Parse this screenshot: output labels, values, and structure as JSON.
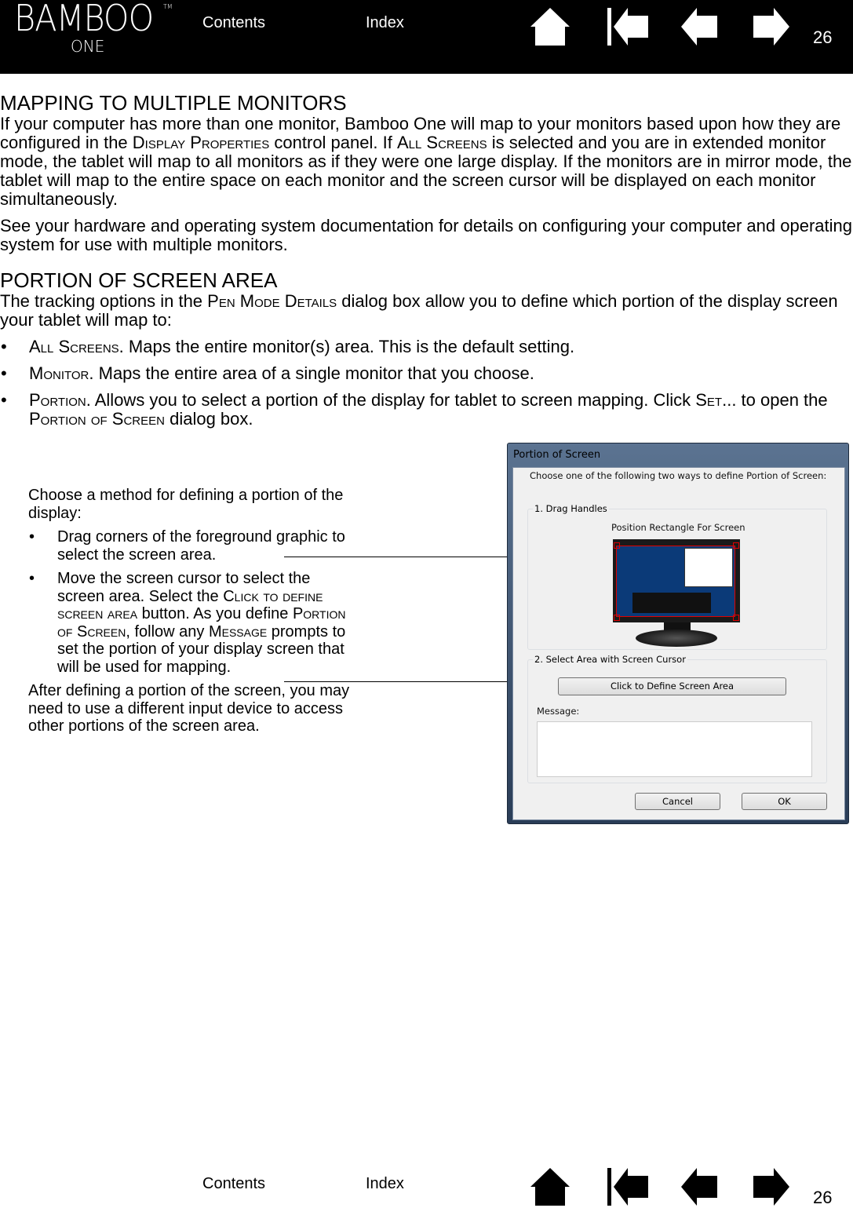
{
  "header": {
    "logo_text": "BAMBOO",
    "logo_sub": "ONE",
    "logo_tm": "TM",
    "contents": "Contents",
    "index": "Index",
    "page_number": "26",
    "icons": [
      "home-icon",
      "first-page-icon",
      "previous-page-icon",
      "next-page-icon"
    ]
  },
  "main": {
    "h1": "MAPPING TO MULTIPLE MONITORS",
    "p1": [
      "If your computer has more than one monitor, Bamboo One will map to your monitors based upon how they are configured in the ",
      "Display Properties",
      " control panel.  If ",
      "All Screens",
      " is selected and you are in extended monitor mode, the tablet will map to all monitors as if they were one large display.  If the monitors are in mirror mode, the tablet will map to the entire space on each monitor and the screen cursor will be displayed on each monitor simultaneously."
    ],
    "p2": "See your hardware and operating system documentation for details on configuring your computer and operating system for use with multiple monitors.",
    "h2": "PORTION OF SCREEN AREA",
    "p3": [
      "The tracking options in the ",
      "Pen Mode Details",
      " dialog box allow you to define which portion of the display screen your tablet will map to:"
    ],
    "bullets": [
      [
        "All Screens",
        ".  Maps the entire monitor(s) area.  This is the default setting."
      ],
      [
        "Monitor",
        ".  Maps the entire area of a single monitor that you choose."
      ],
      [
        "Portion",
        ".  Allows you to select a portion of the display for tablet to screen mapping.  Click ",
        "Set",
        "... to open the ",
        "Portion of Screen",
        " dialog box."
      ]
    ]
  },
  "callout": {
    "intro": "Choose a method for defining a portion of the display:",
    "b1": "Drag corners of the foreground graphic to select the screen area.",
    "b2": [
      "Move the screen cursor to select the screen area.  Select the ",
      "Click to define screen area",
      " button.  As you define ",
      "Portion of Screen",
      ", follow any ",
      "Message",
      " prompts to set the portion of your display screen that will be used for mapping."
    ],
    "after": "After defining a portion of the screen, you may need to use a different input device to access other portions of the screen area."
  },
  "dialog": {
    "title": "Portion of Screen",
    "instruction": "Choose one of the following two ways to define Portion of Screen:",
    "group1": "1. Drag Handles",
    "rect_label": "Position Rectangle For Screen",
    "group2": "2. Select Area with Screen Cursor",
    "define_button": "Click to Define Screen Area",
    "message_label": "Message:",
    "message_value": "",
    "cancel": "Cancel",
    "ok": "OK",
    "handle_color": "#e00000",
    "desktop_color": "#0b3a78"
  },
  "footer": {
    "contents": "Contents",
    "index": "Index",
    "page_number": "26"
  }
}
